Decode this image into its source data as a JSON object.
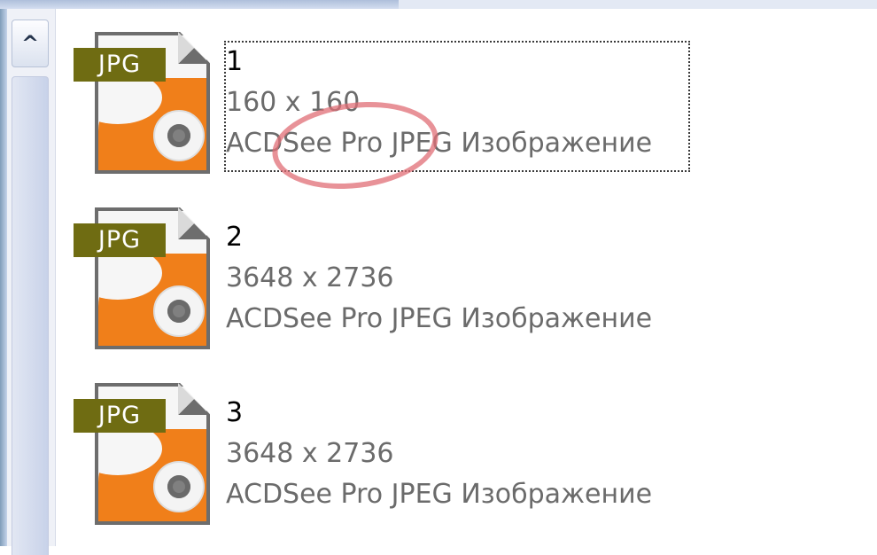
{
  "scrollbar": {
    "up_glyph": "^"
  },
  "files": [
    {
      "name": "1",
      "dimensions": "160 x 160",
      "type": "ACDSee Pro JPEG Изображение",
      "badge": "JPG",
      "selected": true
    },
    {
      "name": "2",
      "dimensions": "3648 x 2736",
      "type": "ACDSee Pro JPEG Изображение",
      "badge": "JPG",
      "selected": false
    },
    {
      "name": "3",
      "dimensions": "3648 x 2736",
      "type": "ACDSee Pro JPEG Изображение",
      "badge": "JPG",
      "selected": false
    }
  ],
  "annotation": {
    "color": "#e06e76"
  },
  "colors": {
    "badge": "#6f6c12",
    "icon_orange": "#f07f1a",
    "secondary_text": "#6b6b6b"
  }
}
